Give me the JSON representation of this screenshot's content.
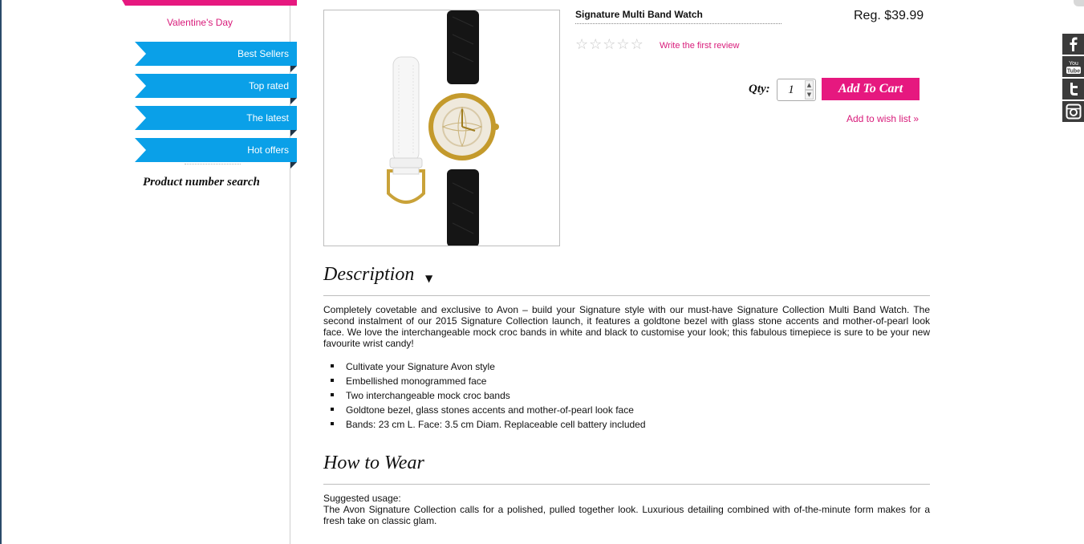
{
  "sidebar": {
    "promo_label": "Valentine's Day",
    "items": [
      {
        "label": "Best Sellers"
      },
      {
        "label": "Top rated"
      },
      {
        "label": "The latest"
      },
      {
        "label": "Hot offers"
      }
    ],
    "product_number_search": "Product number search"
  },
  "product": {
    "title": "Signature Multi Band Watch",
    "price": "Reg. $39.99",
    "rating_stars": 0,
    "review_link": "Write the first review",
    "qty_label": "Qty:",
    "qty_value": "1",
    "add_to_cart": "Add To Cart",
    "wish_list": "Add to wish list »"
  },
  "description": {
    "heading": "Description",
    "text": "Completely covetable and exclusive to Avon – build your Signature style with our must-have Signature Collection Multi Band Watch. The second instalment of our 2015 Signature Collection launch, it features a goldtone bezel with glass stone accents and mother-of-pearl look face. We love the interchangeable mock croc bands in white and black to customise your look; this fabulous timepiece is sure to be your new favourite wrist candy!",
    "bullets": [
      "Cultivate your Signature Avon style",
      "Embellished monogrammed face",
      "Two interchangeable mock croc bands",
      "Goldtone bezel, glass stones accents and mother-of-pearl look face",
      "Bands: 23 cm L. Face: 3.5 cm Diam. Replaceable cell battery included"
    ]
  },
  "how_to_wear": {
    "heading": "How to Wear",
    "label": "Suggested usage:",
    "text": "The Avon Signature Collection calls for a polished, pulled together look. Luxurious detailing combined with of-the-minute form makes for a fresh take on classic glam."
  },
  "social": {
    "icons": [
      "facebook-icon",
      "youtube-icon",
      "twitter-icon",
      "instagram-icon"
    ]
  },
  "colors": {
    "accent_pink": "#e6187f",
    "ribbon_blue": "#0aa0e8"
  }
}
